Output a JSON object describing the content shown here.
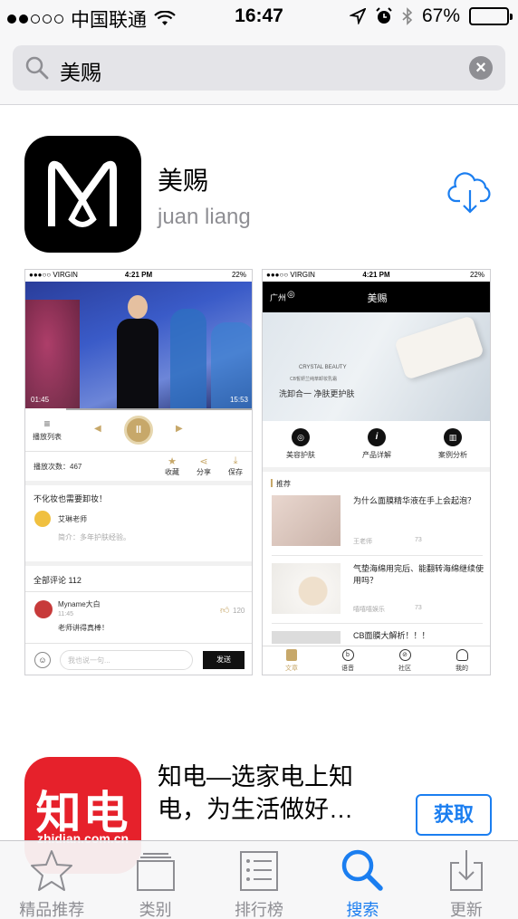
{
  "status_bar": {
    "carrier": "中国联通",
    "time": "16:47",
    "battery": "67%",
    "battery_level": 0.67
  },
  "search": {
    "query": "美赐"
  },
  "results": [
    {
      "name": "美赐",
      "developer": "juan liang",
      "icon": "meici-logo-icon",
      "action": "cloud-download-icon"
    },
    {
      "name": "知电—选家电上知电，为生活做好…",
      "icon_text": "知电",
      "icon_domain": "zhidian.com.cn",
      "action_label": "获取"
    }
  ],
  "screenshot1": {
    "status_left": "●●●○○ VIRGIN",
    "status_time": "4:21 PM",
    "status_right": "22%",
    "time_start": "01:45",
    "time_end": "15:53",
    "playlist_label": "播放列表",
    "play_count": "播放次数：467",
    "actions": [
      "收藏",
      "分享",
      "保存"
    ],
    "title": "不化妆也需要卸妆！",
    "author": "艾琳老师",
    "intro": "简介：多年护肤经验。",
    "comments_header": "全部评论 112",
    "commenter": "Myname大白",
    "comment_time": "11:45",
    "comment_text": "老师讲得真棒！",
    "comment_likes": "120",
    "input_placeholder": "我也说一句...",
    "send_label": "发送"
  },
  "screenshot2": {
    "status_left": "●●●○○ VIRGIN",
    "status_time": "4:21 PM",
    "status_right": "22%",
    "city": "广州",
    "title": "美赐",
    "banner_brand": "CRYSTAL BEAUTY",
    "banner_sub": "CB皙妍兰纯萃卸妆乳霜",
    "banner_slogan": "洗卸合一 净肤更护肤",
    "categories": [
      "美容护肤",
      "产品详解",
      "案例分析"
    ],
    "section": "推荐",
    "articles": [
      {
        "title": "为什么面膜精华液在手上会起泡？",
        "author": "王老师",
        "count": "73"
      },
      {
        "title": "气垫海绵用完后、能翻转海绵继续使用吗？",
        "author": "嘻嘻嘻娱乐",
        "count": "73"
      },
      {
        "title": "CB面膜大解析！！！"
      }
    ],
    "tabs": [
      "文章",
      "语音",
      "社区",
      "我的"
    ]
  },
  "tab_bar": {
    "active_index": 3,
    "tabs": [
      {
        "label": "精品推荐",
        "icon": "star-icon"
      },
      {
        "label": "类别",
        "icon": "stack-icon"
      },
      {
        "label": "排行榜",
        "icon": "list-icon"
      },
      {
        "label": "搜索",
        "icon": "search-icon"
      },
      {
        "label": "更新",
        "icon": "update-icon"
      }
    ]
  },
  "colors": {
    "accent": "#1b7ef0",
    "gold": "#c7a86a",
    "zhidian_red": "#e6212b"
  }
}
